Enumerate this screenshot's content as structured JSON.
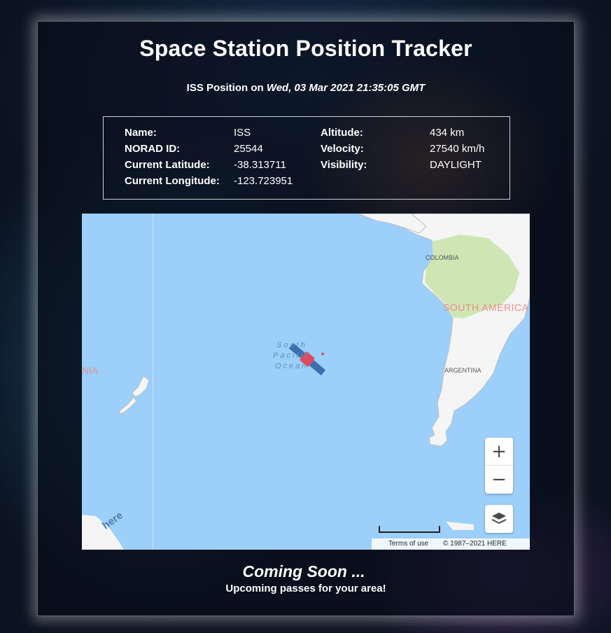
{
  "page": {
    "title": "Space Station Position Tracker",
    "subtitle_prefix": "ISS Position on ",
    "subtitle_time": "Wed, 03 Mar 2021 21:35:05 GMT"
  },
  "info": {
    "name_label": "Name:",
    "name_value": "ISS",
    "norad_label": "NORAD ID:",
    "norad_value": "25544",
    "lat_label": "Current Latitude:",
    "lat_value": "-38.313711",
    "lon_label": "Current Longitude:",
    "lon_value": "-123.723951",
    "alt_label": "Altitude:",
    "alt_value": "434 km",
    "vel_label": "Velocity:",
    "vel_value": "27540 km/h",
    "vis_label": "Visibility:",
    "vis_value": "DAYLIGHT"
  },
  "map": {
    "labels": {
      "colombia": "COLOMBIA",
      "south_america": "SOUTH AMERICA",
      "argentina": "ARGENTINA",
      "ocean_line1": "South",
      "ocean_line2": "Pacific",
      "ocean_line3": "Ocean",
      "nia": "NIA"
    },
    "zoom_in": "+",
    "zoom_out": "−",
    "terms": "Terms of use",
    "copyright": "© 1987–2021 HERE",
    "logo": "here",
    "colors": {
      "water": "#9ccffa",
      "land": "#f4f5f4",
      "forest": "#cfe6b4",
      "label_red": "#e8908a"
    }
  },
  "footer": {
    "coming_soon": "Coming Soon ...",
    "upcoming": "Upcoming passes for your area!"
  }
}
